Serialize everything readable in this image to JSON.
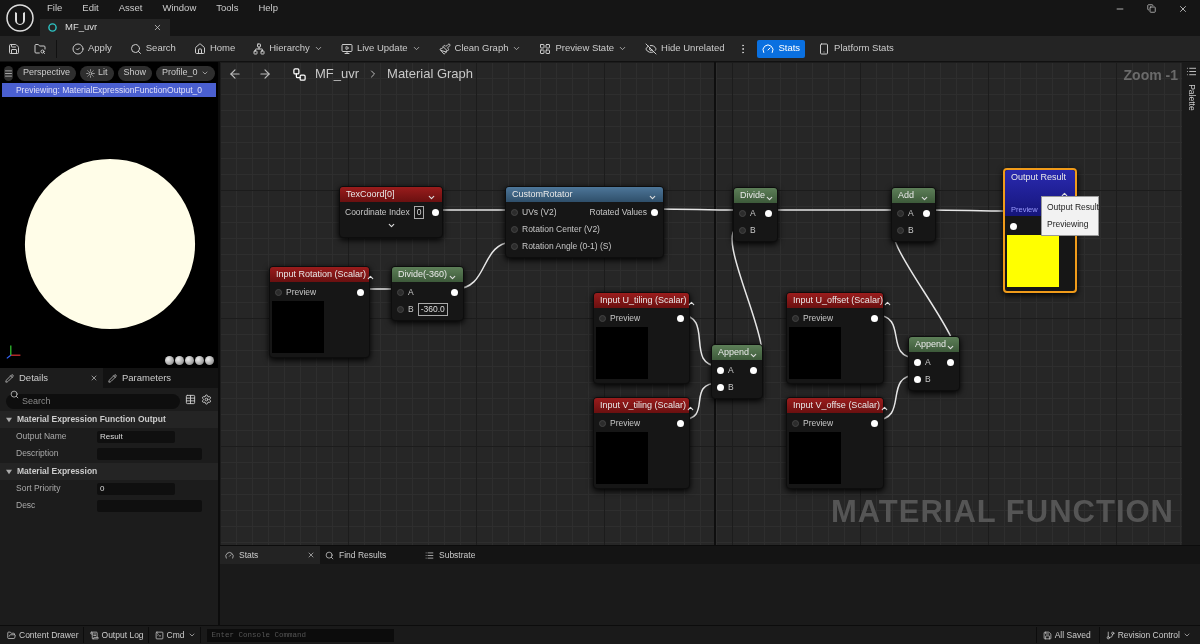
{
  "menu": [
    "File",
    "Edit",
    "Asset",
    "Window",
    "Tools",
    "Help"
  ],
  "document_tab": {
    "title": "MF_uvr",
    "selected": true
  },
  "toolbar": [
    {
      "label": "Apply",
      "kind": "button",
      "selected": false
    },
    {
      "label": "Search",
      "kind": "button",
      "selected": false
    },
    {
      "label": "Home",
      "kind": "button",
      "selected": false
    },
    {
      "label": "Hierarchy",
      "kind": "dropdown",
      "selected": false
    },
    {
      "label": "Live Update",
      "kind": "dropdown",
      "selected": false
    },
    {
      "label": "Clean Graph",
      "kind": "dropdown",
      "selected": false
    },
    {
      "label": "Preview State",
      "kind": "dropdown",
      "selected": false
    },
    {
      "label": "Hide Unrelated",
      "kind": "button",
      "selected": false
    },
    {
      "label": "Stats",
      "kind": "button",
      "selected": true
    },
    {
      "label": "Platform Stats",
      "kind": "button",
      "selected": false
    }
  ],
  "viewport": {
    "buttons": [
      {
        "label": "Perspective",
        "kind": "button"
      },
      {
        "label": "Lit",
        "kind": "icon_button"
      },
      {
        "label": "Show",
        "kind": "button"
      },
      {
        "label": "Profile_0",
        "kind": "dropdown"
      }
    ],
    "status": "Previewing: MaterialExpressionFunctionOutput_0"
  },
  "details": {
    "tabs": [
      {
        "label": "Details",
        "selected": true
      },
      {
        "label": "Parameters",
        "selected": false
      }
    ],
    "search": {
      "placeholder": "Search"
    },
    "sections": [
      {
        "title": "Material Expression Function Output",
        "expanded": true,
        "properties": [
          {
            "name": "Output Name",
            "kind": "short",
            "value": "Result"
          },
          {
            "name": "Description",
            "kind": "long"
          }
        ]
      },
      {
        "title": "Material Expression",
        "expanded": true,
        "properties": [
          {
            "name": "Sort Priority",
            "kind": "short",
            "value": "0"
          },
          {
            "name": "Desc",
            "kind": "long"
          }
        ]
      }
    ]
  },
  "graph": {
    "breadcrumb": [
      "MF_uvr",
      "Material Graph"
    ],
    "zoom": "Zoom -1",
    "label": "MATERIAL FUNCTION",
    "nodes": [
      {
        "title": "TexCoord[0]",
        "kind": "input",
        "selected": false,
        "expanded": false,
        "advanced": true,
        "rows": [
          {
            "label": "Coordinate Index",
            "value": "0",
            "out_linked": true
          }
        ]
      },
      {
        "title": "CustomRotator",
        "kind": "function",
        "selected": false,
        "expanded": false,
        "rows": [
          {
            "label": "UVs (V2)",
            "in_linked": false,
            "out_label": "Rotated Values",
            "out_linked": true
          },
          {
            "label": "Rotation Center (V2)",
            "in_linked": false
          },
          {
            "label": "Rotation Angle (0-1) (S)",
            "in_linked": false
          }
        ]
      },
      {
        "title": "Input Rotation (Scalar)",
        "kind": "input",
        "selected": false,
        "expanded": true,
        "color": "#000000",
        "rows": [
          {
            "label": "Preview",
            "in_linked": false,
            "out_linked": true
          }
        ]
      },
      {
        "title": "Divide(-360)",
        "kind": "math",
        "selected": false,
        "expanded": false,
        "rows": [
          {
            "label": "A",
            "in_linked": false,
            "out_linked": true
          },
          {
            "label": "B",
            "value": "-360.0",
            "in_linked": false
          }
        ]
      },
      {
        "title": "Divide",
        "kind": "math",
        "selected": false,
        "expanded": false,
        "rows": [
          {
            "label": "A",
            "in_linked": false,
            "out_linked": true
          },
          {
            "label": "B",
            "in_linked": false
          }
        ]
      },
      {
        "title": "Add",
        "kind": "math",
        "selected": false,
        "expanded": false,
        "rows": [
          {
            "label": "A",
            "in_linked": false,
            "out_linked": true
          },
          {
            "label": "B",
            "in_linked": false
          }
        ]
      },
      {
        "title": "Output Result",
        "kind": "output",
        "selected": true,
        "expanded": true,
        "subtitle": "Preview",
        "color": "#ffff00",
        "rows": [
          {
            "in_linked": true
          }
        ]
      },
      {
        "title": "Input U_tiling (Scalar)",
        "kind": "input",
        "selected": false,
        "expanded": true,
        "color": "#000000",
        "rows": [
          {
            "label": "Preview",
            "in_linked": false,
            "out_linked": true
          }
        ]
      },
      {
        "title": "Input V_tiling (Scalar)",
        "kind": "input",
        "selected": false,
        "expanded": true,
        "color": "#000000",
        "rows": [
          {
            "label": "Preview",
            "in_linked": false,
            "out_linked": true
          }
        ]
      },
      {
        "title": "Append",
        "kind": "math",
        "selected": false,
        "expanded": false,
        "rows": [
          {
            "label": "A",
            "in_linked": true,
            "out_linked": true
          },
          {
            "label": "B",
            "in_linked": true
          }
        ]
      },
      {
        "title": "Input U_offset (Scalar)",
        "kind": "input",
        "selected": false,
        "expanded": true,
        "color": "#000000",
        "rows": [
          {
            "label": "Preview",
            "in_linked": false,
            "out_linked": true
          }
        ]
      },
      {
        "title": "Input V_offse (Scalar)",
        "kind": "input",
        "selected": false,
        "expanded": true,
        "color": "#000000",
        "rows": [
          {
            "label": "Preview",
            "in_linked": false,
            "out_linked": true
          }
        ]
      },
      {
        "title": "Append",
        "kind": "math",
        "selected": false,
        "expanded": false,
        "rows": [
          {
            "label": "A",
            "in_linked": true,
            "out_linked": true
          },
          {
            "label": "B",
            "in_linked": true
          }
        ]
      }
    ],
    "popup_menu": [
      "Output Result",
      "Previewing"
    ]
  },
  "palette": {
    "label": "Palette"
  },
  "bottom_tabs": [
    {
      "label": "Stats",
      "selected": true
    },
    {
      "label": "Find Results",
      "selected": false
    },
    {
      "label": "Substrate",
      "selected": false
    }
  ],
  "status_bar": {
    "left": [
      {
        "label": "Content Drawer",
        "kind": "button"
      },
      {
        "label": "Output Log",
        "kind": "button"
      },
      {
        "label": "Cmd",
        "kind": "dropdown"
      }
    ],
    "console": {
      "placeholder": "Enter Console Command"
    },
    "right": [
      {
        "label": "All Saved",
        "kind": "button"
      },
      {
        "label": "Revision Control",
        "kind": "dropdown"
      }
    ]
  }
}
